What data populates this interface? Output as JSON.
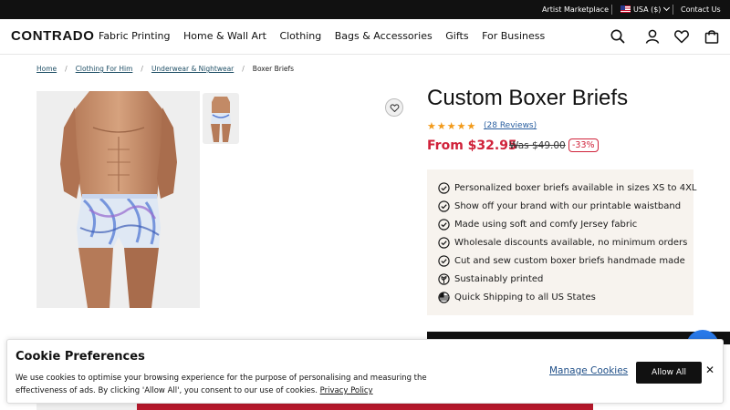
{
  "topbar": {
    "artist_marketplace": "Artist Marketplace",
    "currency": "USA ($)",
    "contact": "Contact Us"
  },
  "header": {
    "logo": "CONTRADO",
    "nav": [
      "Fabric Printing",
      "Home & Wall Art",
      "Clothing",
      "Bags & Accessories",
      "Gifts",
      "For Business"
    ],
    "icons": [
      "search-icon",
      "account-icon",
      "heart-icon",
      "bag-icon"
    ]
  },
  "breadcrumb": {
    "items": [
      "Home",
      "Clothing For Him",
      "Underwear & Nightwear"
    ],
    "current": "Boxer Briefs"
  },
  "product": {
    "title": "Custom Boxer Briefs",
    "rating_stars": "★★★★★",
    "rating_value": 5,
    "reviews": "(28 Reviews)",
    "price": "From $32.95",
    "was_price": "Was $49.00",
    "discount": "-33%",
    "features": [
      {
        "icon": "check-circle-icon",
        "text": "Personalized boxer briefs available in sizes XS to 4XL"
      },
      {
        "icon": "check-circle-icon",
        "text": "Show off your brand with our printable waistband"
      },
      {
        "icon": "check-circle-icon",
        "text": "Made using soft and comfy Jersey fabric"
      },
      {
        "icon": "check-circle-icon",
        "text": "Wholesale discounts available, no minimum orders"
      },
      {
        "icon": "check-circle-icon",
        "text": "Cut and sew custom boxer briefs handmade made"
      },
      {
        "icon": "leaf-icon",
        "text": "Sustainably printed"
      },
      {
        "icon": "us-flag-icon",
        "text": "Quick Shipping to all US States"
      }
    ]
  },
  "cookie": {
    "title": "Cookie Preferences",
    "text": "We use cookies to optimise your browsing experience for the purpose of personalising and measuring the effectiveness of ads. By clicking 'Allow All', you consent to our use of cookies.",
    "policy_link": "Privacy Policy",
    "manage": "Manage Cookies",
    "allow_all": "Allow All",
    "close": "✕"
  },
  "colors": {
    "accent_red": "#d0223a",
    "star_orange": "#f29a1a",
    "link_blue": "#2a5fa0",
    "feature_bg": "#f7f3ee",
    "chat_blue": "#2979e8"
  }
}
